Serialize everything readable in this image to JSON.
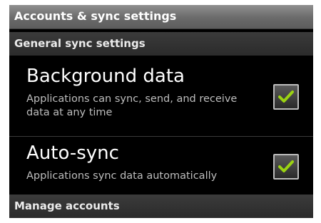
{
  "title_bar": {
    "title": "Accounts & sync settings"
  },
  "sections": {
    "general": {
      "label": "General sync settings"
    },
    "manage": {
      "label": "Manage accounts"
    }
  },
  "prefs": {
    "background_data": {
      "title": "Background data",
      "summary": "Applications can sync, send, and receive data at any time",
      "checked": true
    },
    "auto_sync": {
      "title": "Auto-sync",
      "summary": "Applications sync data automatically",
      "checked": true
    }
  },
  "colors": {
    "check_mark": "#9bd312",
    "background": "#000000",
    "title_bar": "#7a7a7a"
  },
  "icons": {
    "checkbox_checked": "check-icon"
  }
}
